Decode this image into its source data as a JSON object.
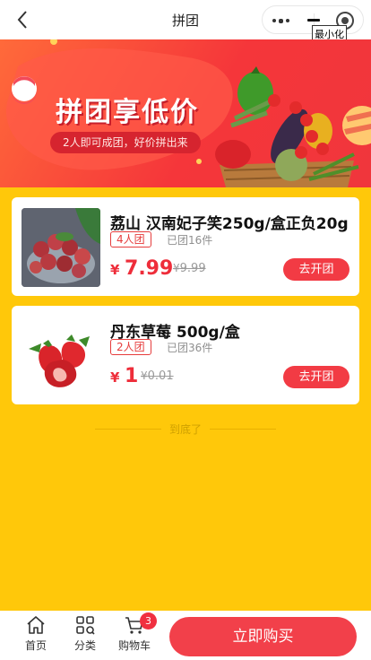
{
  "nav": {
    "title": "拼团",
    "tooltip": "最小化"
  },
  "banner": {
    "title": "拼团享低价",
    "subtitle": "2人即可成团，好价拼出来"
  },
  "products": [
    {
      "name": "荔山 汉南妃子笑250g/盒正负20g",
      "tag": "4人团",
      "sold": "已团16件",
      "currency": "¥",
      "price": "7.99",
      "original_price": "9.99",
      "button": "去开团"
    },
    {
      "name": "丹东草莓 500g/盒",
      "tag": "2人团",
      "sold": "已团36件",
      "currency": "¥",
      "price": "1",
      "original_price": "0.01",
      "button": "去开团"
    }
  ],
  "end_text": "到底了",
  "tabbar": {
    "home": "首页",
    "category": "分类",
    "cart": "购物车",
    "cart_badge": "3",
    "buy": "立即购买"
  },
  "colors": {
    "accent": "#f2404a",
    "background": "#ffc80a"
  }
}
